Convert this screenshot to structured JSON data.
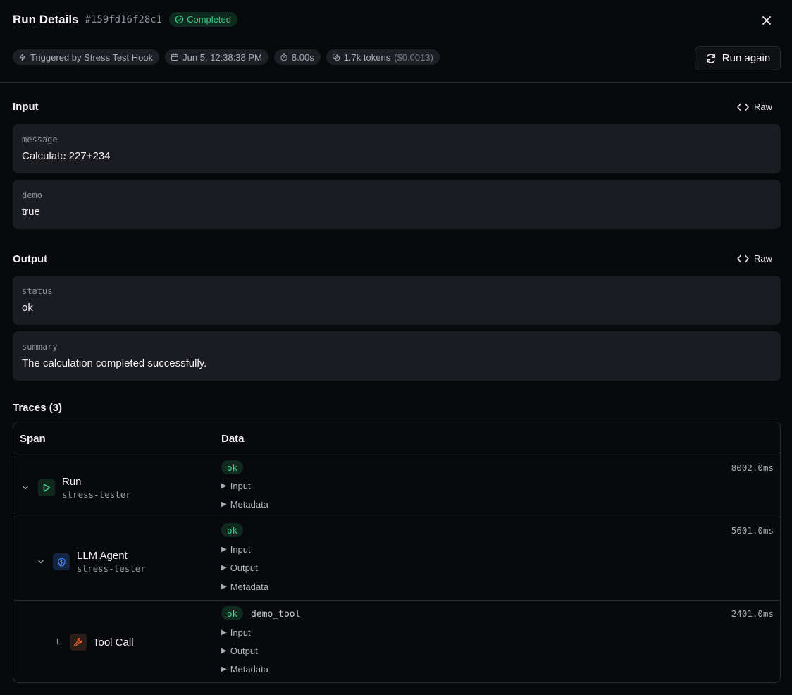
{
  "header": {
    "title": "Run Details",
    "run_id": "#159fd16f28c1",
    "status": "Completed",
    "trigger": "Triggered by Stress Test Hook",
    "datetime": "Jun 5, 12:38:38 PM",
    "duration": "8.00s",
    "tokens": "1.7k tokens",
    "cost": "($0.0013)",
    "run_again_label": "Run again"
  },
  "input": {
    "title": "Input",
    "raw_label": "Raw",
    "fields": [
      {
        "key": "message",
        "value": "Calculate 227+234"
      },
      {
        "key": "demo",
        "value": "true"
      }
    ]
  },
  "output": {
    "title": "Output",
    "raw_label": "Raw",
    "fields": [
      {
        "key": "status",
        "value": "ok"
      },
      {
        "key": "summary",
        "value": "The calculation completed successfully."
      }
    ]
  },
  "traces": {
    "title": "Traces (3)",
    "col_span": "Span",
    "col_data": "Data",
    "rows": [
      {
        "name": "Run",
        "sub": "stress-tester",
        "status": "ok",
        "tool": "",
        "duration": "8002.0ms",
        "items": [
          "Input",
          "Metadata"
        ]
      },
      {
        "name": "LLM Agent",
        "sub": "stress-tester",
        "status": "ok",
        "tool": "",
        "duration": "5601.0ms",
        "items": [
          "Input",
          "Output",
          "Metadata"
        ]
      },
      {
        "name": "Tool Call",
        "sub": "",
        "status": "ok",
        "tool": "demo_tool",
        "duration": "2401.0ms",
        "items": [
          "Input",
          "Output",
          "Metadata"
        ]
      }
    ]
  },
  "colors": {
    "background": "#08090c",
    "card": "#1b1c21",
    "success": "#3fcf8e",
    "run_icon": "#3fcf8e",
    "agent_icon": "#3b82f6",
    "tool_icon": "#f0601f"
  }
}
